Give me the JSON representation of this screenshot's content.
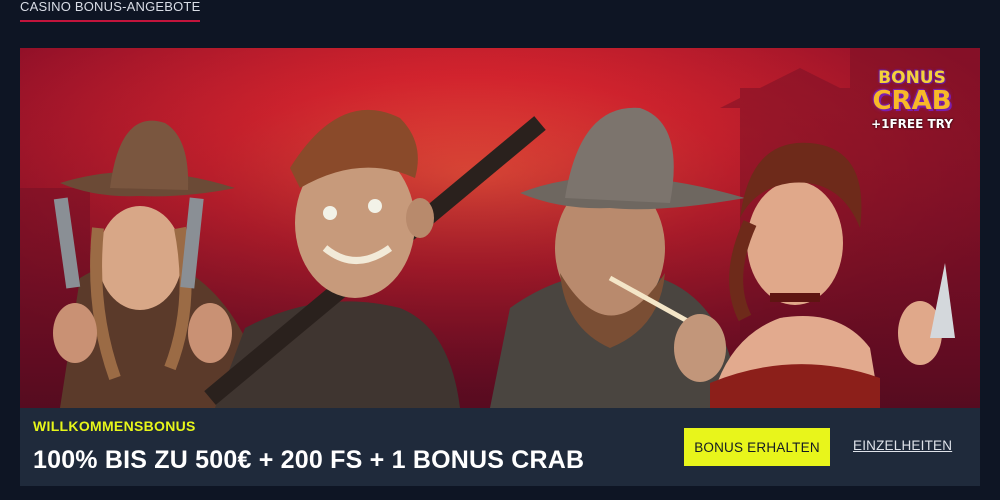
{
  "section": {
    "title": "CASINO BONUS-ANGEBOTE"
  },
  "banner": {
    "logo": {
      "line1": "BONUS",
      "line2": "CRAB",
      "line3": "+1FREE TRY"
    }
  },
  "promo": {
    "label": "WILLKOMMENSBONUS",
    "headline": "100% BIS ZU 500€ + 200 FS + 1 BONUS CRAB",
    "cta_label": "BONUS ERHALTEN",
    "details_label": "EINZELHEITEN"
  },
  "colors": {
    "background": "#0e1524",
    "accent_line": "#c2143c",
    "panel": "#1f2a3b",
    "highlight_yellow": "#e8f51b",
    "banner_red": "#a3132a"
  }
}
